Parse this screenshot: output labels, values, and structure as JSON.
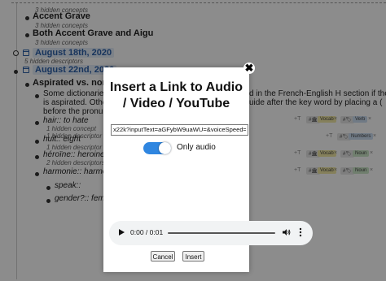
{
  "background": {
    "rows": [
      {
        "kind": "hidden",
        "text": "3 hidden concepts"
      },
      {
        "kind": "item",
        "text": "Accent Grave"
      },
      {
        "kind": "hidden",
        "text": "3 hidden concepts"
      },
      {
        "kind": "item",
        "text": "Both Accent Grave and Aigu"
      },
      {
        "kind": "hidden",
        "text": "3 hidden concepts"
      },
      {
        "kind": "date",
        "text": "August 18th, 2020"
      },
      {
        "kind": "hidden",
        "text": "5 hidden descriptors"
      },
      {
        "kind": "date",
        "text": "August 22nd, 2020"
      },
      {
        "kind": "item",
        "text": "Aspirated vs. non-as"
      },
      {
        "kind": "text",
        "text": "Some dictionaries v"
      },
      {
        "kind": "text",
        "text": "is aspirated. Other c"
      },
      {
        "kind": "text",
        "text": "before the pronuncia"
      },
      {
        "kind": "text",
        "text": "d in the French-English H section if the H"
      },
      {
        "kind": "text",
        "text": "uide after the key word by placing a ("
      },
      {
        "kind": "text",
        "text": "hair:: to hate"
      },
      {
        "kind": "hidden",
        "text": "1 hidden concept"
      },
      {
        "kind": "hidden",
        "text": "1 hidden descriptor"
      },
      {
        "kind": "text",
        "text": "huit:: eight"
      },
      {
        "kind": "hidden",
        "text": "1 hidden descriptor"
      },
      {
        "kind": "text",
        "text": "héroïne:: heroine"
      },
      {
        "kind": "hidden",
        "text": "2 hidden descriptors"
      },
      {
        "kind": "text",
        "text": "harmonie:: harmony"
      },
      {
        "kind": "text",
        "text": "speak::"
      },
      {
        "kind": "text",
        "text": "gender?:: femalo"
      }
    ],
    "tags": [
      [
        "+T",
        "#🏛",
        "Vocab",
        "×",
        "#🏷",
        "Verb",
        "×"
      ],
      [
        "+T",
        "#🏷",
        "Numbers",
        "×"
      ],
      [
        "+T",
        "#🏛",
        "Vocab",
        "×",
        "#🏷",
        "Noun",
        "×"
      ],
      [
        "+T",
        "#🏛",
        "Vocab",
        "×",
        "#🏷",
        "Noun",
        "×"
      ]
    ]
  },
  "modal": {
    "close_glyph": "✖",
    "title": "Insert a Link to Audio / Video / YouTube",
    "url_value": "x22k?inputText=aGFybW9uaWU=&voiceSpeed=85",
    "toggle_label": "Only audio",
    "toggle_on": true,
    "audio": {
      "time": "0:00 / 0:01",
      "play_icon": "play-icon",
      "volume_icon": "volume-icon",
      "more_icon": "more-options-icon"
    },
    "cancel_label": "Cancel",
    "insert_label": "Insert"
  },
  "colors": {
    "accent": "#2f86e0",
    "date": "#2b5fa8",
    "overlay": "rgba(0,0,0,0.45)"
  }
}
